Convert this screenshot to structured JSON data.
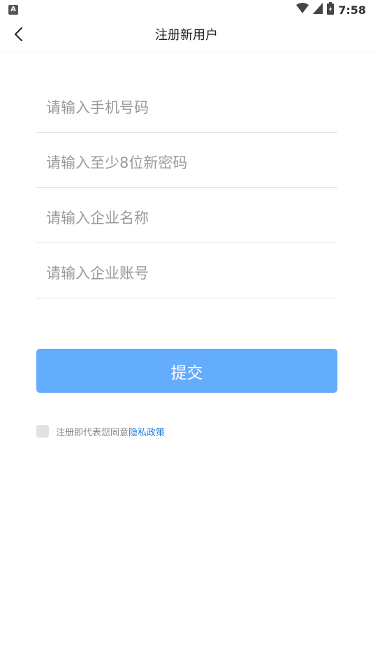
{
  "status_bar": {
    "left_icon_letter": "A",
    "time": "7:58"
  },
  "header": {
    "title": "注册新用户"
  },
  "form": {
    "phone_placeholder": "请输入手机号码",
    "password_placeholder": "请输入至少8位新密码",
    "company_name_placeholder": "请输入企业名称",
    "company_account_placeholder": "请输入企业账号"
  },
  "submit_label": "提交",
  "agreement": {
    "text": "注册即代表您同意",
    "link": "隐私政策"
  },
  "colors": {
    "primary": "#64acfc",
    "link": "#1a7fe0"
  },
  "icons": {
    "back": "chevron-left-icon",
    "wifi": "wifi-icon",
    "signal": "signal-icon",
    "battery": "battery-icon"
  }
}
